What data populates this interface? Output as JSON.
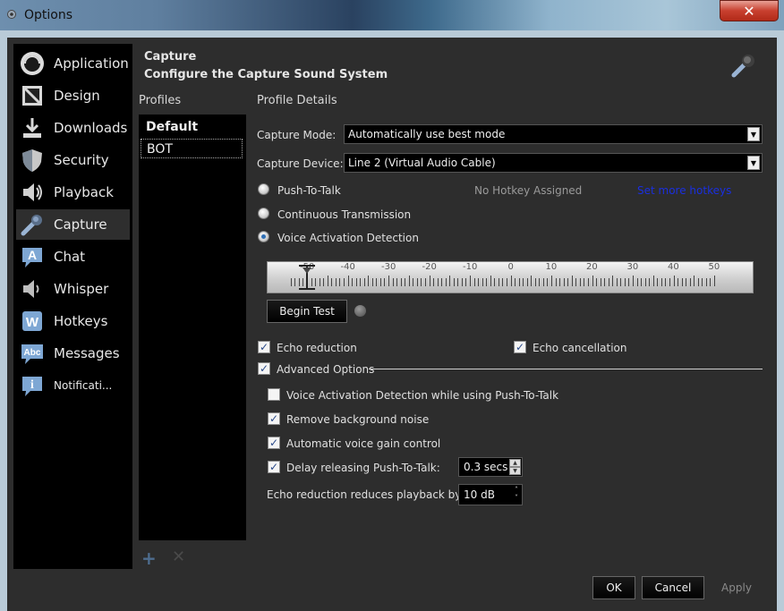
{
  "window": {
    "title": "Options",
    "close_symbol": "✕"
  },
  "sidebar": {
    "items": [
      {
        "label": "Application",
        "icon": "teamspeak-logo-icon"
      },
      {
        "label": "Design",
        "icon": "design-brush-icon"
      },
      {
        "label": "Downloads",
        "icon": "download-arrow-icon"
      },
      {
        "label": "Security",
        "icon": "shield-icon"
      },
      {
        "label": "Playback",
        "icon": "speaker-icon"
      },
      {
        "label": "Capture",
        "icon": "microphone-icon",
        "active": true
      },
      {
        "label": "Chat",
        "icon": "chat-a-icon"
      },
      {
        "label": "Whisper",
        "icon": "speaker-whisper-icon"
      },
      {
        "label": "Hotkeys",
        "icon": "hotkeys-w-icon"
      },
      {
        "label": "Messages",
        "icon": "abc-messages-icon"
      },
      {
        "label": "Notificati...",
        "icon": "info-icon"
      }
    ]
  },
  "header": {
    "title": "Capture",
    "subtitle": "Configure the Capture Sound System"
  },
  "profiles": {
    "label": "Profiles",
    "items": [
      {
        "name": "Default",
        "bold": true
      },
      {
        "name": "BOT",
        "selected": true
      }
    ],
    "add_symbol": "+",
    "remove_symbol": "✕"
  },
  "details": {
    "label": "Profile Details",
    "capture_mode_label": "Capture Mode:",
    "capture_mode_value": "Automatically use best mode",
    "capture_device_label": "Capture Device:",
    "capture_device_value": "Line 2 (Virtual Audio Cable)",
    "ptt_label": "Push-To-Talk",
    "no_hotkey": "No Hotkey Assigned",
    "set_more_hotkeys": "Set more hotkeys",
    "continuous_label": "Continuous Transmission",
    "vad_label": "Voice Activation Detection",
    "selected_mode": "vad",
    "meter": {
      "tick_labels": [
        "-50",
        "-40",
        "-30",
        "-20",
        "-10",
        "0",
        "10",
        "20",
        "30",
        "40",
        "50"
      ],
      "threshold": -50
    },
    "begin_test": "Begin Test",
    "echo_reduction": {
      "label": "Echo reduction",
      "checked": true
    },
    "echo_cancellation": {
      "label": "Echo cancellation",
      "checked": true
    },
    "advanced": {
      "label": "Advanced Options",
      "checked": true
    },
    "vad_while_ptt": {
      "label": "Voice Activation Detection while using Push-To-Talk",
      "checked": false
    },
    "remove_noise": {
      "label": "Remove background noise",
      "checked": true
    },
    "auto_gain": {
      "label": "Automatic voice gain control",
      "checked": true
    },
    "delay_ptt": {
      "label": "Delay releasing Push-To-Talk:",
      "checked": true,
      "value": "0.3 secs"
    },
    "echo_reduce_by_label": "Echo reduction reduces playback by:",
    "echo_reduce_by_value": "10 dB"
  },
  "buttons": {
    "ok": "OK",
    "cancel": "Cancel",
    "apply": "Apply"
  },
  "colors": {
    "background": "#2d2d2d",
    "sidebar": "#000000",
    "link": "#1a2fe0",
    "close": "#c8402f"
  }
}
